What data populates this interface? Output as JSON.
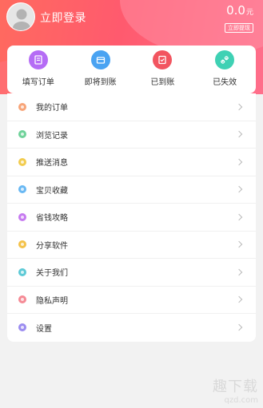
{
  "header": {
    "login_label": "立即登录",
    "balance": "0.0",
    "balance_unit": "元",
    "withdraw_label": "立即提现"
  },
  "orders": [
    {
      "label": "填写订单",
      "icon": "edit-order-icon",
      "color": "#b56cf5"
    },
    {
      "label": "即将到账",
      "icon": "pending-box-icon",
      "color": "#4aa3f2"
    },
    {
      "label": "已到账",
      "icon": "received-icon",
      "color": "#f25560"
    },
    {
      "label": "已失效",
      "icon": "expired-link-icon",
      "color": "#3fd1b4"
    }
  ],
  "menu": [
    {
      "label": "我的订单",
      "color": "#f7a478"
    },
    {
      "label": "浏览记录",
      "color": "#6fd29a"
    },
    {
      "label": "推送消息",
      "color": "#f2cc4f"
    },
    {
      "label": "宝贝收藏",
      "color": "#69b8f3"
    },
    {
      "label": "省钱攻略",
      "color": "#c67af0"
    },
    {
      "label": "分享软件",
      "color": "#f4c24a"
    },
    {
      "label": "关于我们",
      "color": "#5ecad6"
    },
    {
      "label": "隐私声明",
      "color": "#f58a95"
    },
    {
      "label": "设置",
      "color": "#9b8cf0"
    }
  ],
  "watermark": {
    "text": "趣下载",
    "url": "qzd.com"
  }
}
